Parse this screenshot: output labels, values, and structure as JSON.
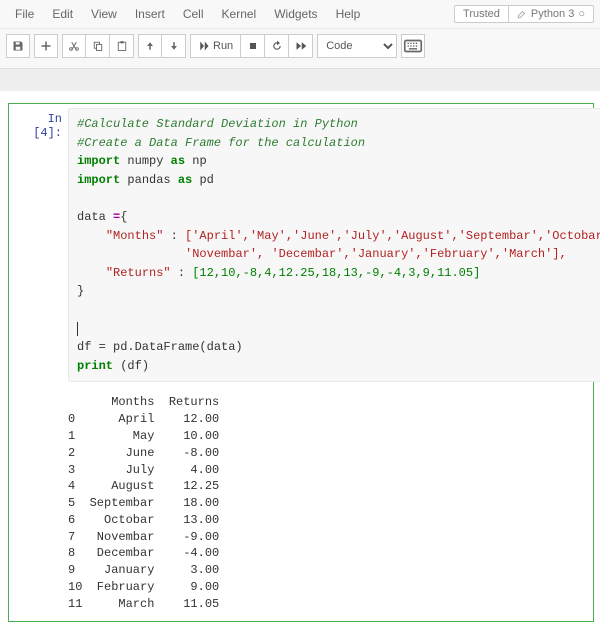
{
  "menu": {
    "file": "File",
    "edit": "Edit",
    "view": "View",
    "insert": "Insert",
    "cell": "Cell",
    "kernel": "Kernel",
    "widgets": "Widgets",
    "help": "Help"
  },
  "header": {
    "trusted": "Trusted",
    "kernel_name": "Python 3",
    "kernel_indicator": "○"
  },
  "toolbar": {
    "run_label": "Run",
    "celltype": "Code"
  },
  "cell": {
    "prompt": "In [4]:",
    "comment1": "#Calculate Standard Deviation in Python",
    "comment2": "#Create a Data Frame for the calculation",
    "kw_import": "import",
    "kw_as": "as",
    "mod_numpy": "numpy",
    "alias_np": "np",
    "mod_pandas": "pandas",
    "alias_pd": "pd",
    "var_data": "data",
    "eq": "=",
    "brace_open": "{",
    "brace_close": "}",
    "key_months": "\"Months\"",
    "colon": " : ",
    "months_line1": "['April','May','June','July','August','Septembar','Octobar',",
    "months_line2": "'Novembar', 'Decembar','January','February','March'],",
    "key_returns": "\"Returns\"",
    "returns_list": "[12,10,-8,4,12.25,18,13,-9,-4,3,9,11.05]",
    "df_assign": "df = pd.DataFrame(data)",
    "kw_print": "print",
    "print_arg": " (df)"
  },
  "output_header": "      Months  Returns",
  "output_rows": [
    "0      April    12.00",
    "1        May    10.00",
    "2       June    -8.00",
    "3       July     4.00",
    "4     August    12.25",
    "5  Septembar    18.00",
    "6    Octobar    13.00",
    "7   Novembar    -9.00",
    "8   Decembar    -4.00",
    "9    January     3.00",
    "10  February     9.00",
    "11     March    11.05"
  ]
}
